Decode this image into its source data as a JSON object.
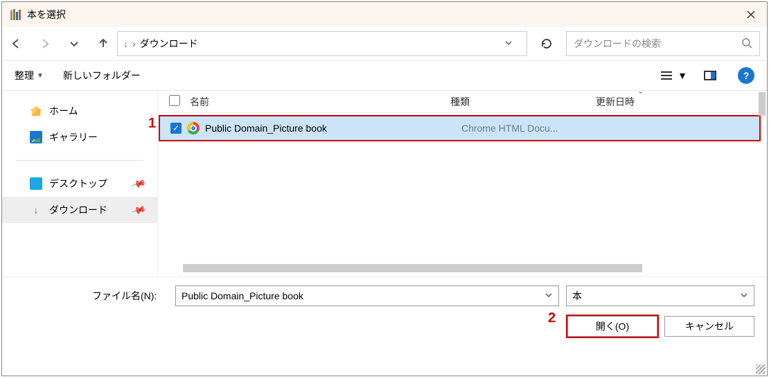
{
  "title": "本を選択",
  "breadcrumb": {
    "current": "ダウンロード"
  },
  "search": {
    "placeholder": "ダウンロードの検索"
  },
  "toolbar": {
    "organize": "整理",
    "newfolder": "新しいフォルダー"
  },
  "sidebar": {
    "home": "ホーム",
    "gallery": "ギャラリー",
    "desktop": "デスクトップ",
    "downloads": "ダウンロード"
  },
  "columns": {
    "name": "名前",
    "type": "種類",
    "date": "更新日時"
  },
  "file": {
    "name": "Public Domain_Picture book",
    "type": "Chrome HTML Docu..."
  },
  "filename_label": "ファイル名(N):",
  "filename_value": "Public Domain_Picture book",
  "filetype_value": "本",
  "open_label": "開く(O)",
  "cancel_label": "キャンセル",
  "annotations": {
    "one": "1",
    "two": "2"
  }
}
